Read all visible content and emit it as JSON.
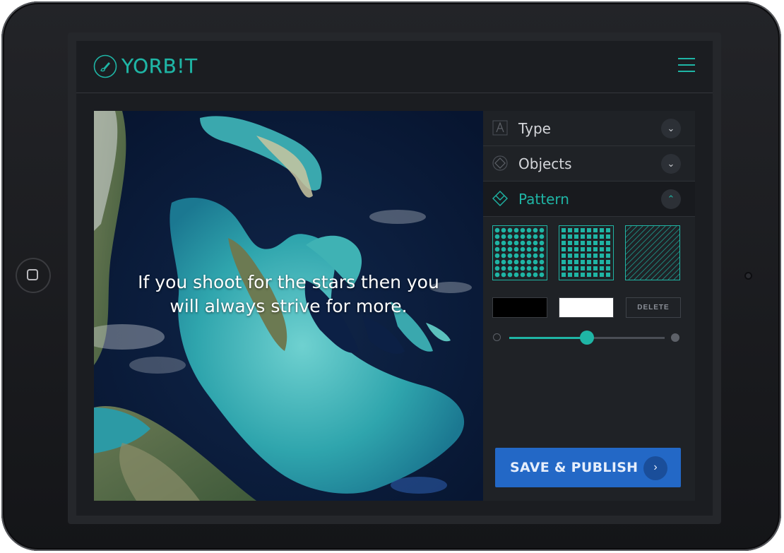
{
  "app": {
    "logo_text": "YORB!T",
    "brand_color": "#1fb5a5",
    "icons": {
      "logo": "paintbrush-icon",
      "menu": "hamburger-menu-icon"
    }
  },
  "canvas": {
    "quote_lines": [
      "If you shoot for the stars then you",
      "will always strive for more."
    ],
    "background_image": "satellite view of islands and turquoise shallow sea"
  },
  "panel": {
    "sections": [
      {
        "label": "Type",
        "icon": "text-type-icon",
        "expanded": false
      },
      {
        "label": "Objects",
        "icon": "objects-diamond-icon",
        "expanded": false
      },
      {
        "label": "Pattern",
        "icon": "pattern-layers-icon",
        "expanded": true
      }
    ],
    "patterns": [
      "dots-pattern",
      "squares-pattern",
      "diagonal-lines-pattern"
    ],
    "swatches": {
      "primary": "#000000",
      "secondary": "#ffffff"
    },
    "delete_label": "DELETE",
    "slider_value": 0.5,
    "save_label": "SAVE & PUBLISH",
    "save_color": "#2368c6"
  }
}
